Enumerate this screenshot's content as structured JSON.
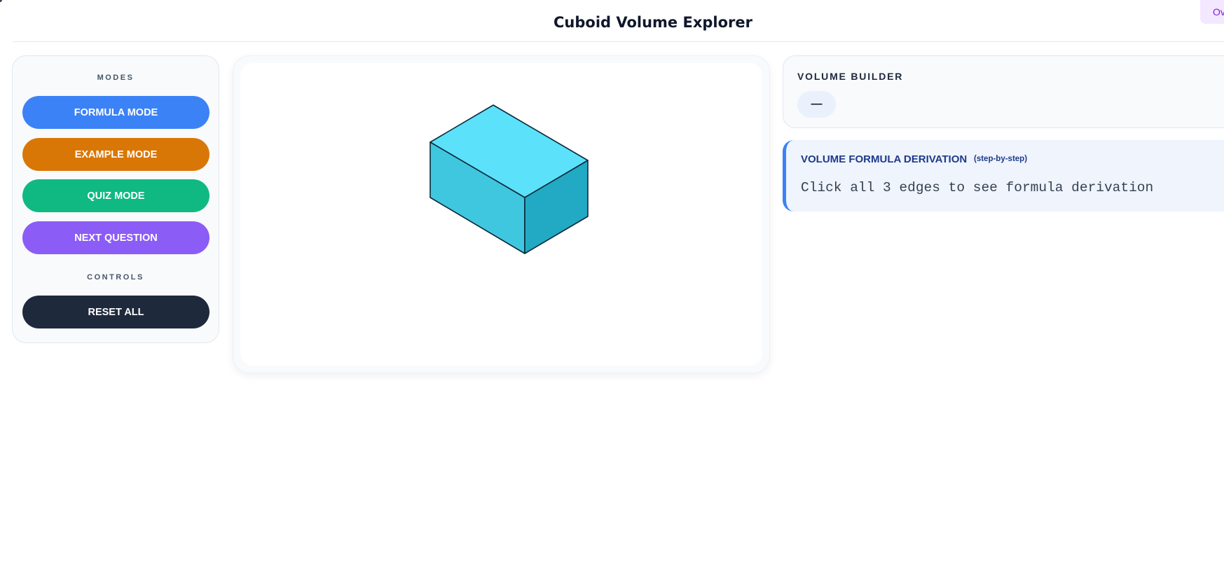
{
  "header": {
    "title": "Cuboid Volume Explorer",
    "overlay_chip": "Ov"
  },
  "sidebar": {
    "modes_label": "MODES",
    "controls_label": "CONTROLS",
    "buttons": {
      "formula": "FORMULA MODE",
      "example": "EXAMPLE MODE",
      "quiz": "QUIZ MODE",
      "next": "NEXT QUESTION",
      "reset": "RESET ALL"
    }
  },
  "builder": {
    "title": "VOLUME BUILDER",
    "value": "—"
  },
  "derivation": {
    "title": "VOLUME FORMULA DERIVATION",
    "subtitle": "(step-by-step)",
    "message": "Click all 3 edges to see formula derivation"
  },
  "colors": {
    "formula": "#3b82f6",
    "example": "#d97706",
    "quiz": "#10b981",
    "next": "#8b5cf6",
    "reset": "#1e293b",
    "cuboid_top": "#5ce1fa",
    "cuboid_front": "#40c7e0",
    "cuboid_side": "#22a9c4",
    "cuboid_stroke": "#0b2a3a",
    "accent": "#3b82f6"
  },
  "icons": {
    "corner": "corner-dot-icon"
  }
}
